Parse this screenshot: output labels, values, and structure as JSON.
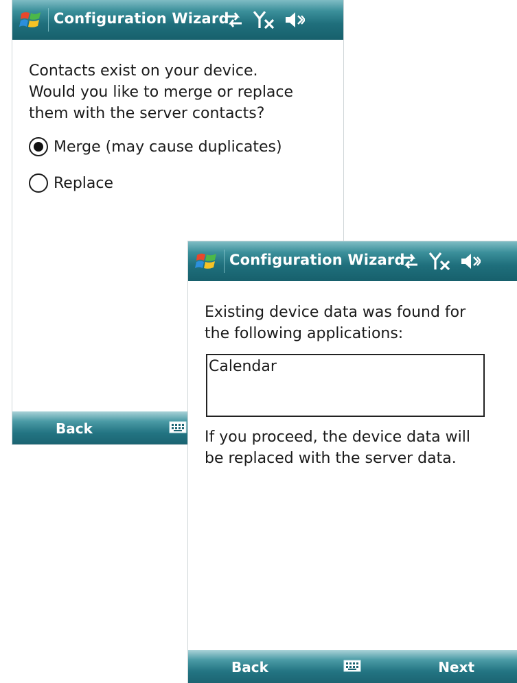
{
  "screens": [
    {
      "title": "Configuration Wizard",
      "prompt_lines": [
        "Contacts exist on your device.",
        "Would you like to merge or replace",
        "them with the server contacts?"
      ],
      "options": [
        {
          "label": "Merge (may cause duplicates)",
          "selected": true
        },
        {
          "label": "Replace",
          "selected": false
        }
      ],
      "softkeys": {
        "left": "Back",
        "right": ""
      },
      "status_icons": [
        "sync-arrows-icon",
        "no-signal-icon",
        "speaker-muted-icon"
      ]
    },
    {
      "title": "Configuration Wizard",
      "message_lines": [
        "Existing device data was found for",
        "the following applications:"
      ],
      "list_items": [
        "Calendar"
      ],
      "footer_lines": [
        "If you proceed, the device data will",
        "be replaced with the server data."
      ],
      "softkeys": {
        "left": "Back",
        "right": "Next"
      },
      "status_icons": [
        "sync-arrows-icon",
        "no-signal-icon",
        "speaker-muted-icon"
      ]
    }
  ],
  "colors": {
    "titlebar": "#1f6f7c",
    "softkeybar": "#237482",
    "text": "#1a1a1a"
  }
}
